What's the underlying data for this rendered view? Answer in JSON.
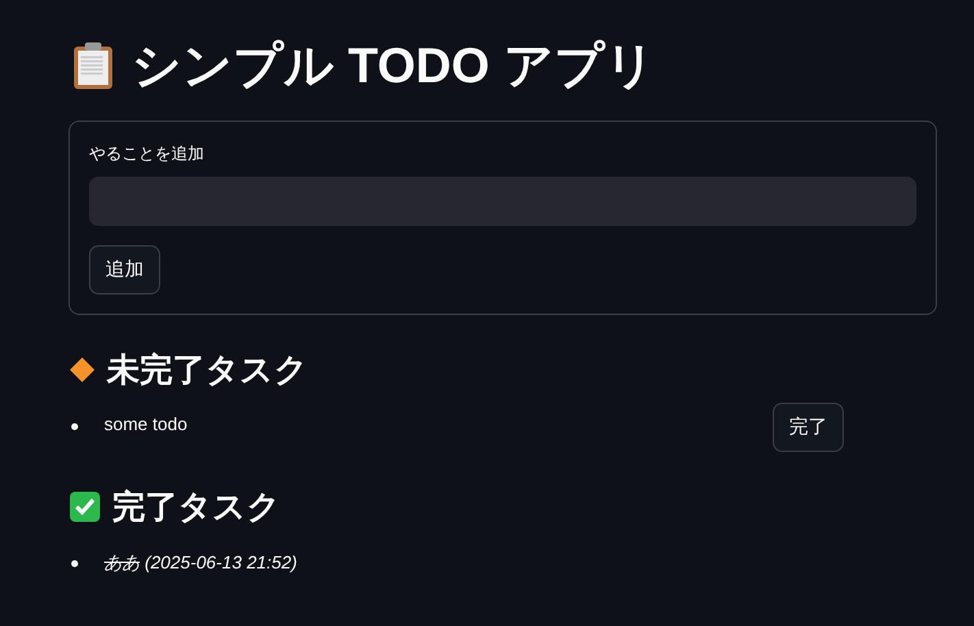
{
  "title": "シンプル TODO アプリ",
  "add_form": {
    "label": "やることを追加",
    "button": "追加"
  },
  "pending_section": {
    "heading": "未完了タスク",
    "items": [
      {
        "text": "some todo",
        "completed": false,
        "button": "完了"
      }
    ]
  },
  "done_section": {
    "heading": "完了タスク",
    "items": [
      {
        "text": "ああ",
        "completed": true,
        "timestamp": "(2025-06-13 21:52)"
      }
    ]
  }
}
